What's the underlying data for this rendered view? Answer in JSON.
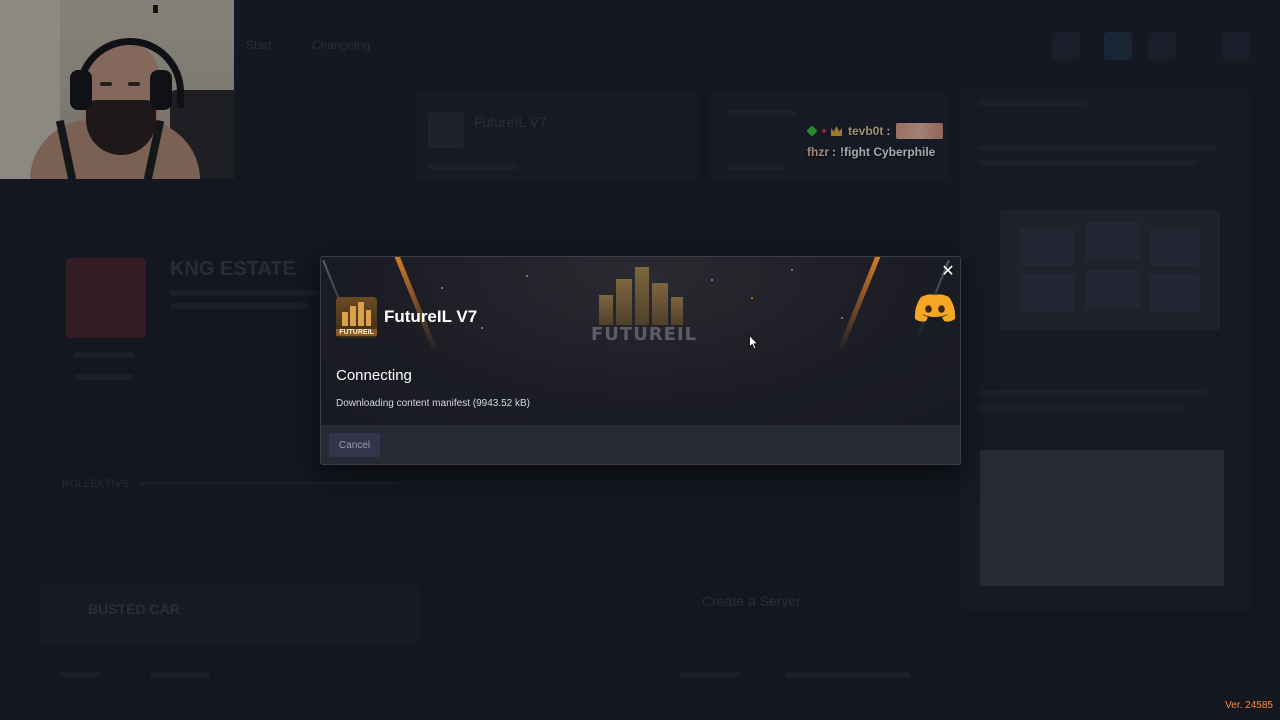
{
  "background_app": {
    "nav": [
      "Start",
      "Changelog"
    ],
    "cards": [
      "FutureIL V7"
    ],
    "featured_title": "KNG ESTATE",
    "section_label": "KOLLEKTIVS",
    "secondary_title": "Create a Server",
    "other_server": "BUSTED CAR"
  },
  "chat": {
    "messages": [
      {
        "user": "tevb0t",
        "separator": ":",
        "text": "",
        "badges": [
          "green-gem-icon",
          "red-dot-icon",
          "crown-icon"
        ],
        "emote": true
      },
      {
        "user": "fhzr",
        "separator": ":",
        "text": "!fight Cyberphile",
        "badges": [],
        "emote": false
      }
    ]
  },
  "modal": {
    "server_name": "FutureIL V7",
    "banner_logo_text": "FUTUREIL",
    "icon_label": "FUTUREIL",
    "status_title": "Connecting",
    "status_detail": "Downloading content manifest (9943.52 kB)",
    "close_symbol": "✕",
    "cancel_label": "Cancel"
  },
  "version": "Ver. 24585",
  "colors": {
    "accent": "#f08a2a",
    "modal_bg": "#1a1c26",
    "footer_bg": "#272a35",
    "version_text": "#ff8a3a"
  }
}
